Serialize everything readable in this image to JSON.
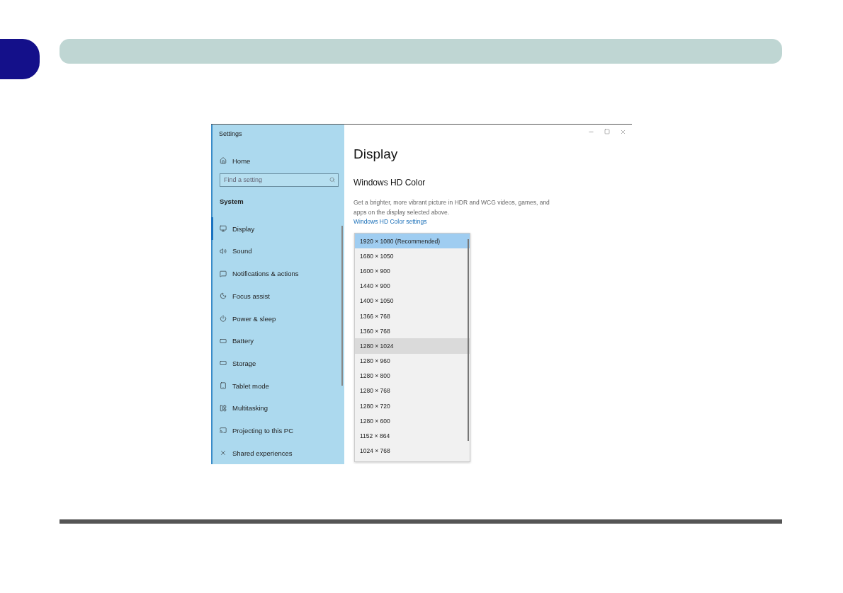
{
  "window": {
    "title": "Settings"
  },
  "sidebar": {
    "home": "Home",
    "search": {
      "placeholder": "Find a setting"
    },
    "section": "System",
    "items": [
      {
        "label": "Display",
        "selected": true
      },
      {
        "label": "Sound",
        "selected": false
      },
      {
        "label": "Notifications & actions",
        "selected": false
      },
      {
        "label": "Focus assist",
        "selected": false
      },
      {
        "label": "Power & sleep",
        "selected": false
      },
      {
        "label": "Battery",
        "selected": false
      },
      {
        "label": "Storage",
        "selected": false
      },
      {
        "label": "Tablet mode",
        "selected": false
      },
      {
        "label": "Multitasking",
        "selected": false
      },
      {
        "label": "Projecting to this PC",
        "selected": false
      },
      {
        "label": "Shared experiences",
        "selected": false
      }
    ]
  },
  "main": {
    "title": "Display",
    "section": "Windows HD Color",
    "description": "Get a brighter, more vibrant picture in HDR and WCG videos, games, and apps on the display selected above.",
    "link": "Windows HD Color settings"
  },
  "resolution_menu": [
    {
      "label": "1920 × 1080 (Recommended)",
      "selected": true,
      "hovered": false
    },
    {
      "label": "1680 × 1050",
      "selected": false,
      "hovered": false
    },
    {
      "label": "1600 × 900",
      "selected": false,
      "hovered": false
    },
    {
      "label": "1440 × 900",
      "selected": false,
      "hovered": false
    },
    {
      "label": "1400 × 1050",
      "selected": false,
      "hovered": false
    },
    {
      "label": "1366 × 768",
      "selected": false,
      "hovered": false
    },
    {
      "label": "1360 × 768",
      "selected": false,
      "hovered": false
    },
    {
      "label": "1280 × 1024",
      "selected": false,
      "hovered": true
    },
    {
      "label": "1280 × 960",
      "selected": false,
      "hovered": false
    },
    {
      "label": "1280 × 800",
      "selected": false,
      "hovered": false
    },
    {
      "label": "1280 × 768",
      "selected": false,
      "hovered": false
    },
    {
      "label": "1280 × 720",
      "selected": false,
      "hovered": false
    },
    {
      "label": "1280 × 600",
      "selected": false,
      "hovered": false
    },
    {
      "label": "1152 × 864",
      "selected": false,
      "hovered": false
    },
    {
      "label": "1024 × 768",
      "selected": false,
      "hovered": false
    }
  ]
}
